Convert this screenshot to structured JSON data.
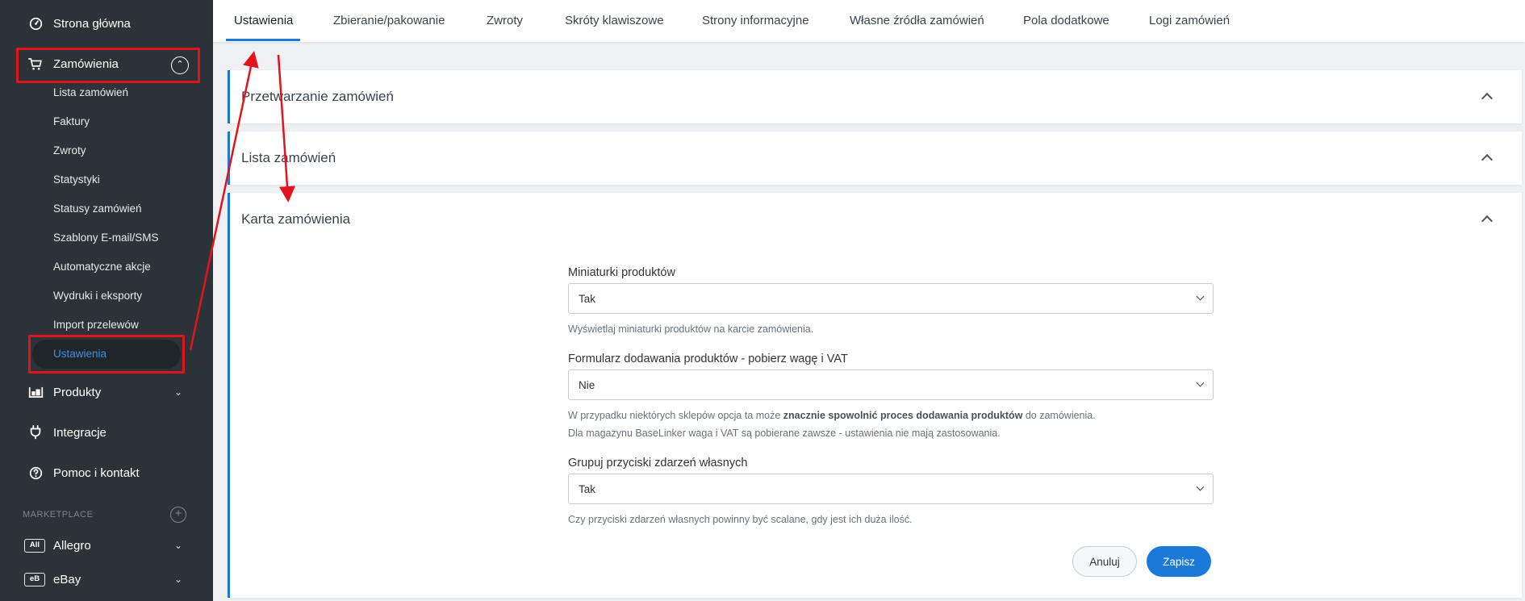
{
  "sidebar": {
    "home": {
      "label": "Strona główna",
      "icon": "dashboard-icon"
    },
    "orders": {
      "label": "Zamówienia",
      "icon": "cart-icon"
    },
    "orders_sub": [
      "Lista zamówień",
      "Faktury",
      "Zwroty",
      "Statystyki",
      "Statusy zamówień",
      "Szablony E-mail/SMS",
      "Automatyczne akcje",
      "Wydruki i eksporty",
      "Import przelewów",
      "Ustawienia"
    ],
    "products": {
      "label": "Produkty",
      "icon": "warehouse-icon"
    },
    "integrations": {
      "label": "Integracje",
      "icon": "plug-icon"
    },
    "help": {
      "label": "Pomoc i kontakt",
      "icon": "question-icon"
    },
    "marketplace_label": "MARKETPLACE",
    "marketplaces": [
      {
        "badge": "All",
        "label": "Allegro"
      },
      {
        "badge": "eB",
        "label": "eBay"
      }
    ]
  },
  "tabs": [
    "Ustawienia",
    "Zbieranie/pakowanie",
    "Zwroty",
    "Skróty klawiszowe",
    "Strony informacyjne",
    "Własne źródła zamówień",
    "Pola dodatkowe",
    "Logi zamówień"
  ],
  "panels": {
    "processing": "Przetwarzanie zamówień",
    "list": "Lista zamówień",
    "card": "Karta zamówienia"
  },
  "form": {
    "thumbnails": {
      "label": "Miniaturki produktów",
      "value": "Tak",
      "help": "Wyświetlaj miniaturki produktów na karcie zamówienia."
    },
    "add_form": {
      "label": "Formularz dodawania produktów - pobierz wagę i VAT",
      "value": "Nie",
      "help_pre": "W przypadku niektórych sklepów opcja ta może ",
      "help_bold": "znacznie spowolnić proces dodawania produktów",
      "help_post": " do zamówienia.",
      "help2": "Dla magazynu BaseLinker waga i VAT są pobierane zawsze - ustawienia nie mają zastosowania."
    },
    "group_buttons": {
      "label": "Grupuj przyciski zdarzeń własnych",
      "value": "Tak",
      "help": "Czy przyciski zdarzeń własnych powinny być scalane, gdy jest ich duża ilość."
    },
    "cancel_label": "Anuluj",
    "save_label": "Zapisz"
  },
  "colors": {
    "sidebar_bg": "#2c3338",
    "accent": "#1b7ad9",
    "annotation_red": "#e3131d"
  }
}
